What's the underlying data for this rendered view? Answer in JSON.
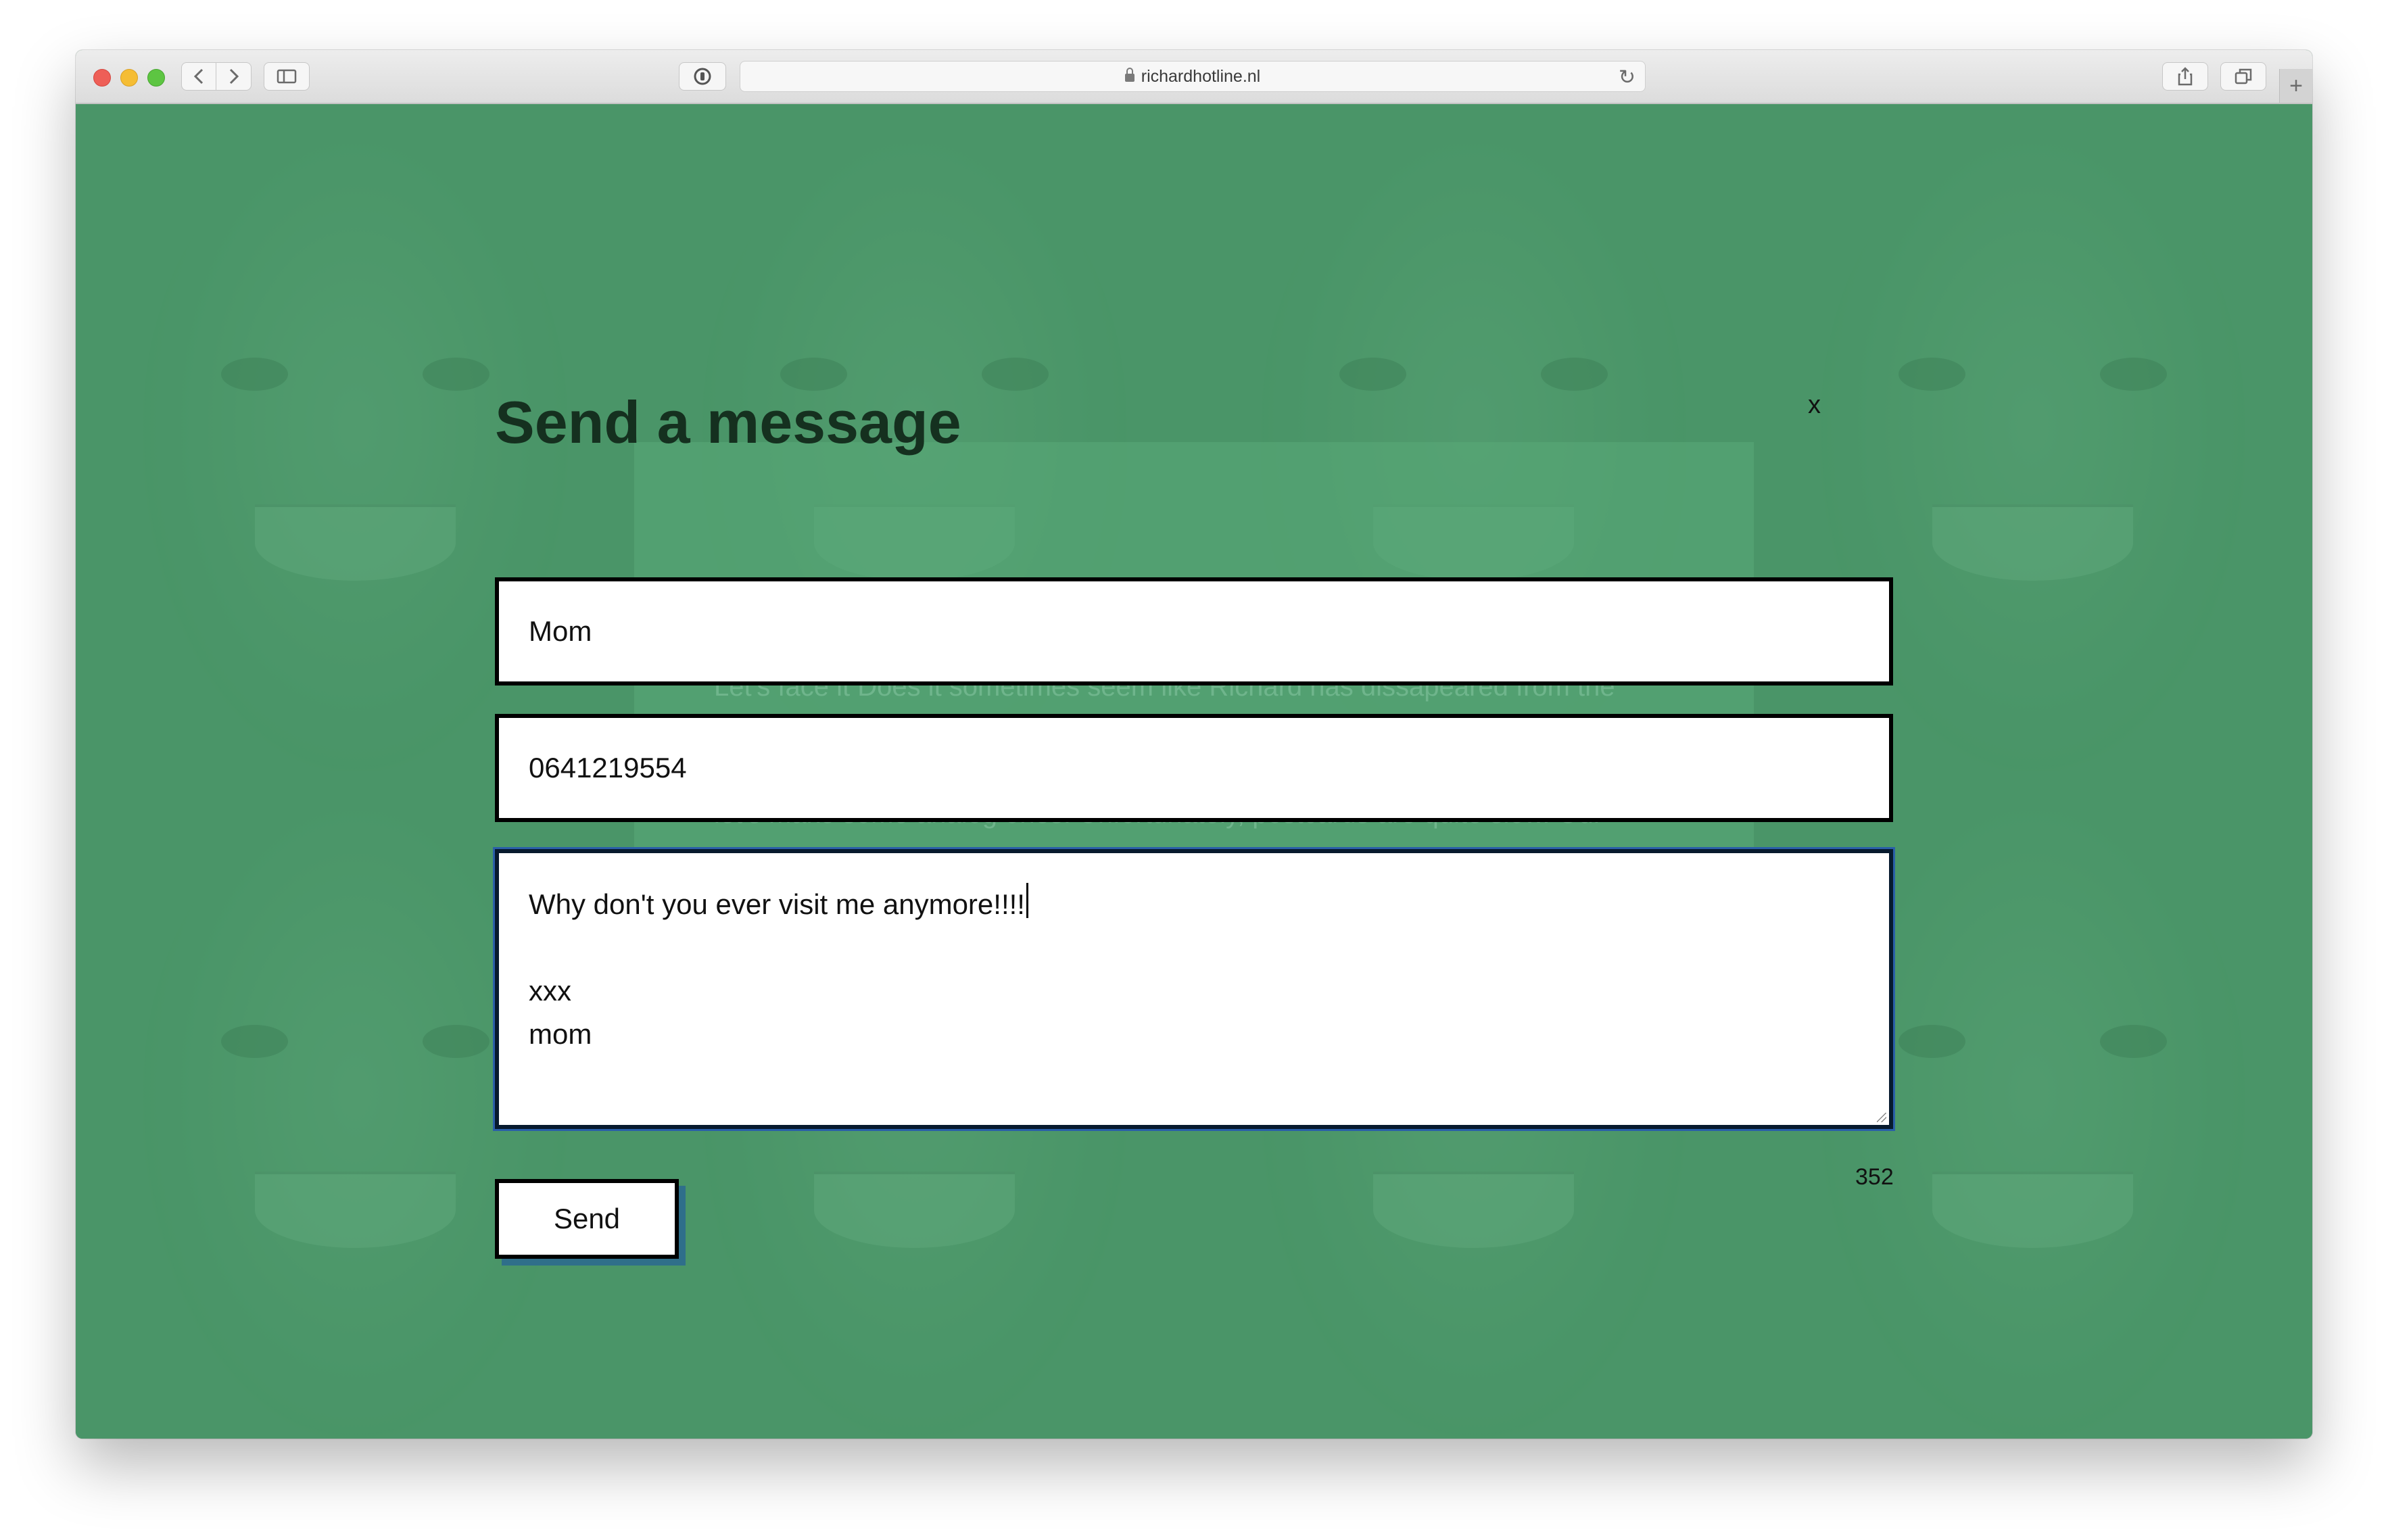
{
  "browser": {
    "url": "richardhotline.nl",
    "icons": {
      "back": "chevron-left-icon",
      "forward": "chevron-right-icon",
      "sidebar": "sidebar-icon",
      "privacy": "privacy-report-icon",
      "lock": "lock-icon",
      "reload": "reload-icon",
      "share": "share-icon",
      "tabs": "tab-overview-icon",
      "new_tab": "plus-icon"
    }
  },
  "colors": {
    "page_background": "#4a9568",
    "title_text": "#15301f",
    "send_shadow": "#2f6f8a"
  },
  "background_text": {
    "line1": "Let's face it Does it sometimes seem like Richard has dissapeared from the",
    "line2": "let's make some analog ones. Unfortunately, postcards are quite slow. Our"
  },
  "modal": {
    "title": "Send a message",
    "close_label": "x",
    "name_value": "Mom",
    "phone_value": "0641219554",
    "message_value": "Why don't you ever visit me anymore!!!!\n\nxxx\nmom",
    "char_counter": "352",
    "send_label": "Send"
  }
}
